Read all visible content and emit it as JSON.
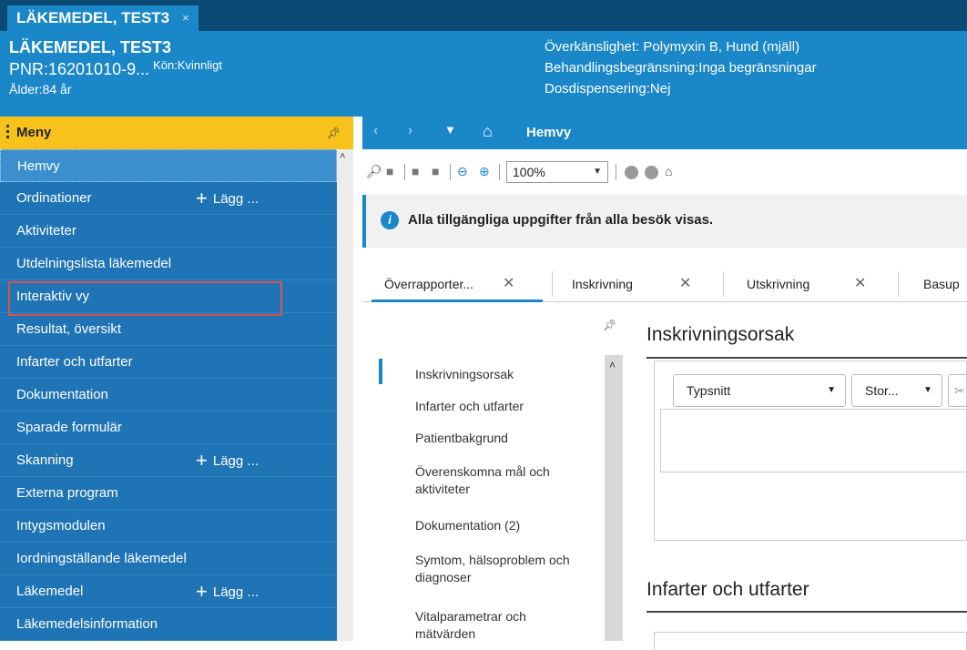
{
  "tabbar": {
    "tab_label": "LÄKEMEDEL, TEST3",
    "tab_close": "×"
  },
  "header": {
    "name": "LÄKEMEDEL, TEST3",
    "pnr": "PNR:16201010-9...",
    "kon": "Kön:Kvinnligt",
    "alder": "Ålder:84 år",
    "overkanslighet": "Överkänslighet: Polymyxin B, Hund (mjäll)",
    "behandlingsbegransning": "Behandlingsbegränsning:Inga begränsningar",
    "dosdispensering": "Dosdispensering:Nej"
  },
  "menu": {
    "title": "Meny",
    "items": [
      {
        "label": "Hemvy"
      },
      {
        "label": "Ordinationer",
        "add": "Lägg ..."
      },
      {
        "label": "Aktiviteter"
      },
      {
        "label": "Utdelningslista läkemedel"
      },
      {
        "label": "Interaktiv vy"
      },
      {
        "label": "Resultat, översikt"
      },
      {
        "label": "Infarter och utfarter"
      },
      {
        "label": "Dokumentation"
      },
      {
        "label": "Sparade formulär"
      },
      {
        "label": "Skanning",
        "add": "Lägg ..."
      },
      {
        "label": "Externa program"
      },
      {
        "label": "Intygsmodulen"
      },
      {
        "label": "Iordningställande läkemedel"
      },
      {
        "label": "Läkemedel",
        "add": "Lägg ..."
      },
      {
        "label": "Läkemedelsinformation"
      }
    ]
  },
  "nav": {
    "title": "Hemvy"
  },
  "toolbar": {
    "zoom": "100%"
  },
  "info": {
    "text": "Alla tillgängliga uppgifter från alla besök visas."
  },
  "doc_tabs": [
    {
      "label": "Överrapporter..."
    },
    {
      "label": "Inskrivning"
    },
    {
      "label": "Utskrivning"
    },
    {
      "label": "Basup"
    }
  ],
  "sections": [
    "Inskrivningsorsak",
    "Infarter och utfarter",
    "Patientbakgrund",
    "Överenskomna mål och aktiviteter",
    "Dokumentation (2)",
    "Symtom, hälsoproblem och diagnoser",
    "Vitalparametrar och mätvärden"
  ],
  "content": {
    "section1_title": "Inskrivningsorsak",
    "font_select": "Typsnitt",
    "size_select": "Stor...",
    "section2_title": "Infarter och utfarter"
  },
  "colors": {
    "header_blue": "#1a87c9",
    "tabbar_dark": "#0b4a74",
    "sidebar_blue": "#1f74b6",
    "menu_yellow": "#f6c21b",
    "highlight_red": "#d9534f"
  }
}
